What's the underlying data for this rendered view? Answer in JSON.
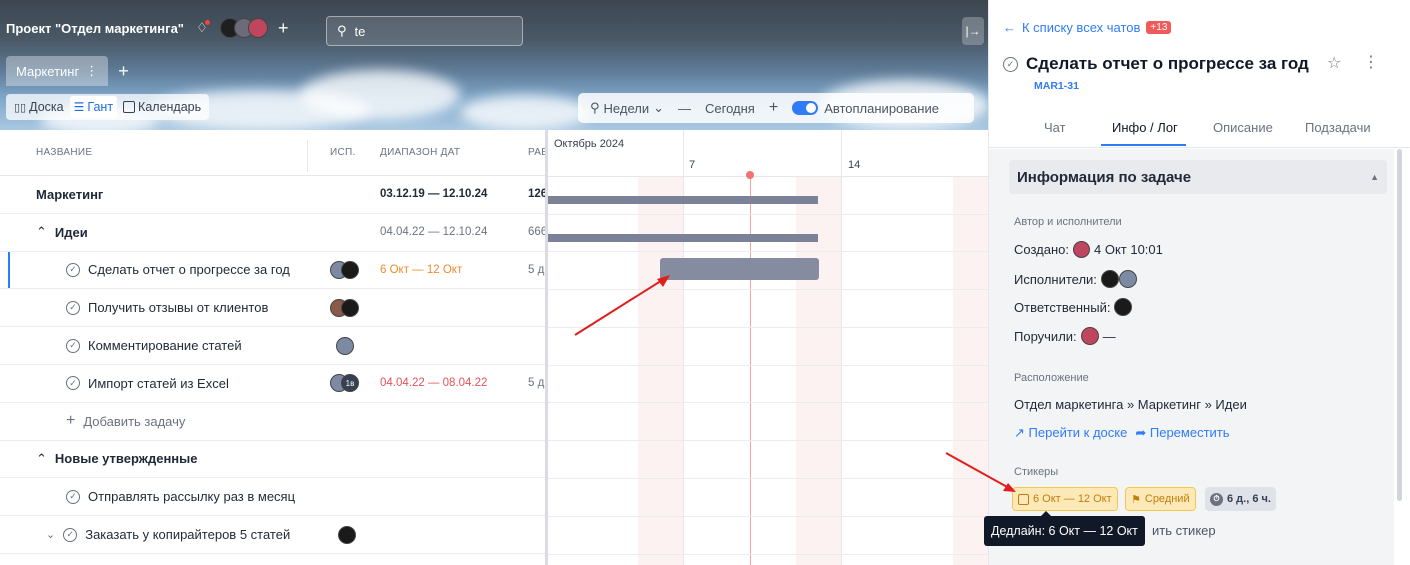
{
  "header": {
    "project_title": "Проект \"Отдел маркетинга\"",
    "search_value": "te",
    "board_tab": "Маркетинг"
  },
  "views": {
    "board": "Доска",
    "gantt": "Гант",
    "calendar": "Календарь"
  },
  "gantt_controls": {
    "scale": "Недели",
    "today": "Сегодня",
    "autoplan": "Автопланирование"
  },
  "table": {
    "columns": {
      "name": "НАЗВАНИЕ",
      "isp": "ИСП.",
      "range": "ДИАПАЗОН ДАТ",
      "ra": "РАБ"
    },
    "rows": [
      {
        "name": "Маркетинг",
        "range": "03.12.19 — 12.10.24",
        "ra": "126"
      },
      {
        "name": "Идеи",
        "range": "04.04.22 — 12.10.24",
        "ra": "666"
      },
      {
        "name": "Сделать отчет о прогрессе за год",
        "range": "6 Окт — 12 Окт",
        "ra": "5 д"
      },
      {
        "name": "Получить отзывы от клиентов"
      },
      {
        "name": "Комментирование статей"
      },
      {
        "name": "Импорт статей из Excel",
        "range": "04.04.22 — 08.04.22",
        "ra": "5 д",
        "avatar_badge": "1в"
      },
      {
        "name": "Добавить задачу"
      },
      {
        "name": "Новые утвержденные"
      },
      {
        "name": "Отправлять рассылку раз в месяц"
      },
      {
        "name": "Заказать у копирайтеров 5 статей"
      }
    ]
  },
  "gantt": {
    "month": "Октябрь 2024",
    "day1": "7",
    "day2": "14"
  },
  "panel": {
    "back": "К списку всех чатов",
    "badge": "+13",
    "title": "Сделать отчет о прогрессе за год",
    "code": "MAR1-31",
    "tabs": [
      "Чат",
      "Инфо / Лог",
      "Описание",
      "Подзадачи"
    ],
    "section": "Информация по задаче",
    "authors_label": "Автор и исполнители",
    "created_label": "Создано:",
    "created_value": "4 Окт 10:01",
    "assignees_label": "Исполнители:",
    "responsible_label": "Ответственный:",
    "delegated_label": "Поручили:",
    "delegated_value": "—",
    "location_label": "Расположение",
    "location_value": "Отдел маркетинга » Маркетинг » Идеи",
    "goto_board": "Перейти к доске",
    "move": "Переместить",
    "stickers_label": "Стикеры",
    "sticker_date": "6 Окт — 12 Окт",
    "sticker_priority": "Средний",
    "sticker_time": "6 д., 6 ч.",
    "tooltip": "Дедлайн: 6 Окт — 12 Окт",
    "add_sticker_partial": "ить стикер"
  },
  "colors": {
    "accent": "#2f7cf6",
    "orange_date": "#f08a2a",
    "red_date": "#e5535a",
    "bar": "#868c9f",
    "today": "#f07373"
  }
}
